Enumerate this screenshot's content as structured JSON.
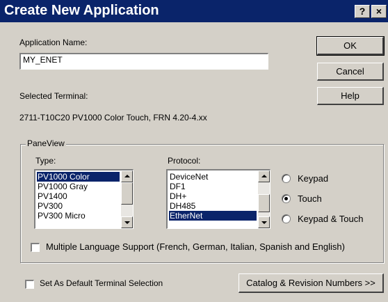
{
  "window": {
    "title": "Create New Application",
    "help_glyph": "?",
    "close_glyph": "×"
  },
  "app_name": {
    "label": "Application Name:",
    "value": "MY_ENET"
  },
  "buttons": {
    "ok": "OK",
    "cancel": "Cancel",
    "help": "Help",
    "catalog": "Catalog & Revision Numbers >>"
  },
  "terminal": {
    "label": "Selected Terminal:",
    "value": "2711-T10C20 PV1000 Color Touch, FRN 4.20-4.xx"
  },
  "panelview": {
    "group_title": "PaneView",
    "type_label": "Type:",
    "types": [
      "PV1000 Color",
      "PV1000 Gray",
      "PV1400",
      "PV300",
      "PV300 Micro"
    ],
    "type_selected_index": 0,
    "protocol_label": "Protocol:",
    "protocols": [
      "DeviceNet",
      "DF1",
      "DH+",
      "DH485",
      "EtherNet"
    ],
    "protocol_selected_index": 4,
    "input_modes": [
      "Keypad",
      "Touch",
      "Keypad & Touch"
    ],
    "input_mode_selected": "Touch",
    "multi_language_label": "Multiple Language Support (French, German, Italian, Spanish and English)",
    "multi_language_checked": false
  },
  "default_terminal": {
    "label": "Set As Default Terminal Selection",
    "checked": false
  },
  "colors": {
    "titlebar": "#0a246a",
    "face": "#d4d0c8",
    "selection": "#0a246a"
  }
}
